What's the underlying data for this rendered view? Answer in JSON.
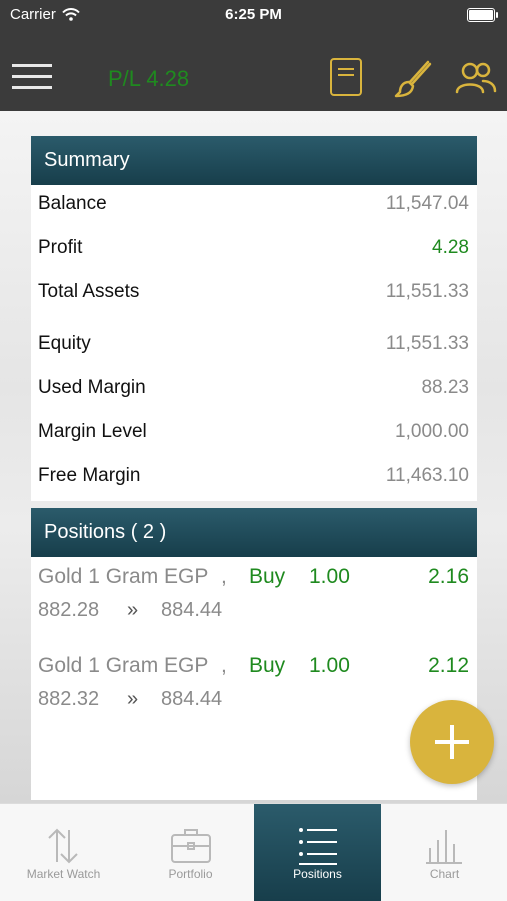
{
  "status_bar": {
    "carrier": "Carrier",
    "time": "6:25 PM"
  },
  "header": {
    "pl_label": "P/L 4.28",
    "icons": [
      "book-icon",
      "brush-icon",
      "users-icon"
    ]
  },
  "summary": {
    "title": "Summary",
    "rows": [
      {
        "label": "Balance",
        "value": "11,547.04"
      },
      {
        "label": "Profit",
        "value": "4.28"
      },
      {
        "label": "Total Assets",
        "value": "11,551.33"
      },
      {
        "label": "Equity",
        "value": "11,551.33"
      },
      {
        "label": "Used Margin",
        "value": "88.23"
      },
      {
        "label": "Margin Level",
        "value": "1,000.00"
      },
      {
        "label": "Free Margin",
        "value": "11,463.10"
      }
    ]
  },
  "positions": {
    "title": "Positions ( 2 )",
    "items": [
      {
        "symbol": "Gold 1 Gram EGP",
        "separator": ",",
        "side": "Buy",
        "volume": "1.00",
        "profit": "2.16",
        "open_price": "882.28",
        "arrow": "»",
        "current_price": "884.44"
      },
      {
        "symbol": "Gold 1 Gram EGP",
        "separator": ",",
        "side": "Buy",
        "volume": "1.00",
        "profit": "2.12",
        "open_price": "882.32",
        "arrow": "»",
        "current_price": "884.44"
      }
    ]
  },
  "tabs": [
    {
      "label": "Market Watch",
      "icon": "arrows-updown-icon",
      "active": false
    },
    {
      "label": "Portfolio",
      "icon": "briefcase-icon",
      "active": false
    },
    {
      "label": "Positions",
      "icon": "list-icon",
      "active": true
    },
    {
      "label": "Chart",
      "icon": "bar-chart-icon",
      "active": false
    }
  ],
  "colors": {
    "accent_gold": "#d9b43d",
    "header_teal": "#1f4a58",
    "profit_green": "#1f8a1f",
    "nav_dark": "#3b3b3b"
  }
}
